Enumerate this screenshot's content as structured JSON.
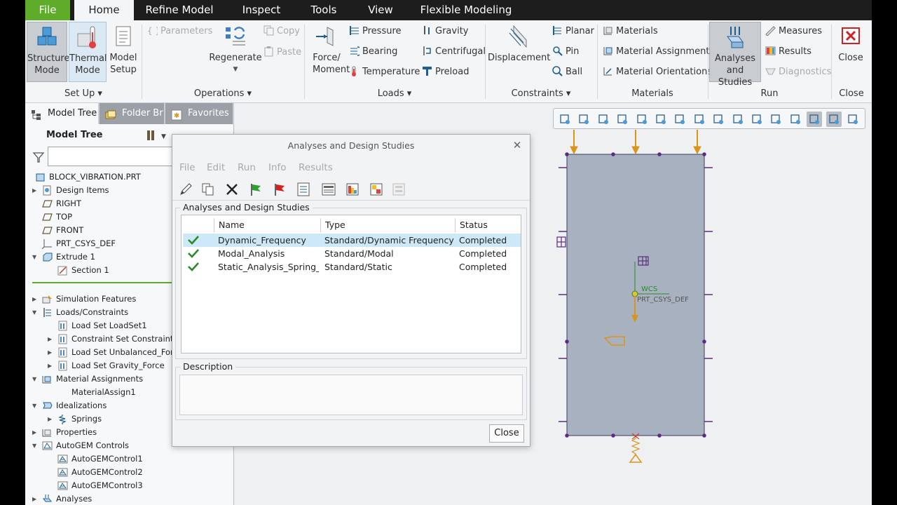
{
  "ribbon_tabs": {
    "file": "File",
    "home": "Home",
    "refine_model": "Refine Model",
    "inspect": "Inspect",
    "tools": "Tools",
    "view": "View",
    "flexible_modeling": "Flexible Modeling"
  },
  "setup": {
    "structure_mode": "Structure Mode",
    "thermal_mode": "Thermal Mode",
    "model_setup": "Model Setup",
    "group_label": "Set Up ▾"
  },
  "operations": {
    "parameters": "Parameters",
    "regenerate": "Regenerate",
    "copy": "Copy",
    "paste": "Paste",
    "group_label": "Operations ▾"
  },
  "loads": {
    "force_moment": "Force/ Moment",
    "pressure": "Pressure",
    "bearing": "Bearing",
    "temperature": "Temperature",
    "gravity": "Gravity",
    "centrifugal": "Centrifugal",
    "preload": "Preload",
    "group_label": "Loads ▾"
  },
  "constraints": {
    "displacement": "Displacement",
    "planar": "Planar",
    "pin": "Pin",
    "ball": "Ball",
    "group_label": "Constraints ▾"
  },
  "materials": {
    "materials": "Materials",
    "material_assignment": "Material Assignment",
    "material_orientations": "Material Orientations",
    "group_label": "Materials"
  },
  "run": {
    "analyses_and_studies": "Analyses and Studies",
    "measures": "Measures",
    "results": "Results",
    "diagnostics": "Diagnostics",
    "group_label": "Run"
  },
  "close_group": {
    "close": "Close",
    "group_label": "Close"
  },
  "nav_tabs": {
    "model_tree": "Model Tree",
    "folder_browser": "Folder Br",
    "favorites": "Favorites"
  },
  "tree": {
    "title": "Model Tree",
    "items": [
      {
        "label": "BLOCK_VIBRATION.PRT"
      },
      {
        "label": "Design Items"
      },
      {
        "label": "RIGHT"
      },
      {
        "label": "TOP"
      },
      {
        "label": "FRONT"
      },
      {
        "label": "PRT_CSYS_DEF"
      },
      {
        "label": "Extrude 1"
      },
      {
        "label": "Section 1"
      },
      {
        "label": "Simulation Features"
      },
      {
        "label": "Loads/Constraints"
      },
      {
        "label": "Load Set LoadSet1"
      },
      {
        "label": "Constraint Set ConstraintSe"
      },
      {
        "label": "Load Set Unbalanced_Forc"
      },
      {
        "label": "Load Set Gravity_Force"
      },
      {
        "label": "Material Assignments"
      },
      {
        "label": "MaterialAssign1"
      },
      {
        "label": "Idealizations"
      },
      {
        "label": "Springs"
      },
      {
        "label": "Properties"
      },
      {
        "label": "AutoGEM Controls"
      },
      {
        "label": "AutoGEMControl1"
      },
      {
        "label": "AutoGEMControl2"
      },
      {
        "label": "AutoGEMControl3"
      },
      {
        "label": "Analyses"
      }
    ]
  },
  "dialog": {
    "title": "Analyses and Design Studies",
    "menu": {
      "file": "File",
      "edit": "Edit",
      "run": "Run",
      "info": "Info",
      "results": "Results"
    },
    "list_legend": "Analyses and Design Studies",
    "columns": {
      "name": "Name",
      "type": "Type",
      "status": "Status"
    },
    "rows": [
      {
        "name": "Dynamic_Frequency",
        "type": "Standard/Dynamic Frequency",
        "status": "Completed"
      },
      {
        "name": "Modal_Analysis",
        "type": "Standard/Modal",
        "status": "Completed"
      },
      {
        "name": "Static_Analysis_Spring_De",
        "type": "Standard/Static",
        "status": "Completed"
      }
    ],
    "description_legend": "Description",
    "close_button": "Close"
  },
  "viewport": {
    "wcs_label": "WCS",
    "csys_label": "PRT_CSYS_DEF"
  },
  "colors": {
    "file_tab": "#5fac2b",
    "selection": "#cde8f7",
    "part_fill": "#a8b1c0",
    "load_arrow": "#d9951b",
    "constraint": "#5b2c83",
    "close_x": "#d32020"
  }
}
